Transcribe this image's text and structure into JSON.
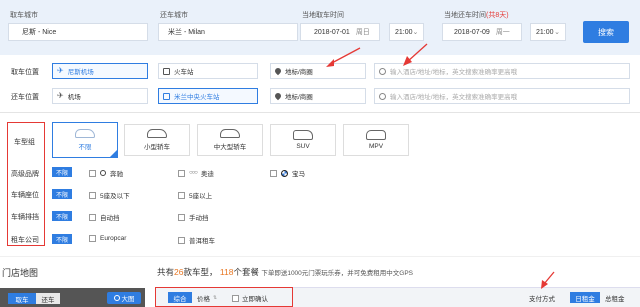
{
  "search": {
    "pickup_city_label": "取车城市",
    "pickup_city": "尼斯 - Nice",
    "return_city_label": "还车城市",
    "return_city": "米兰 - Milan",
    "pickup_time_label": "当地取车时间",
    "pickup_date": "2018-07-01",
    "pickup_weekday": "周日",
    "pickup_hour": "21:00",
    "return_time_label": "当地还车时间",
    "return_days_note": "(共8天)",
    "return_date": "2018-07-09",
    "return_weekday": "周一",
    "return_hour": "21:00",
    "search_button": "搜索"
  },
  "pickup_row": {
    "label": "取车位置",
    "options": [
      "尼斯机场",
      "火车站",
      "地标/商圈"
    ],
    "search_placeholder": "输入酒店/地址/地标，英文搜索准确率更高哦"
  },
  "return_row": {
    "label": "还车位置",
    "options": [
      "机场",
      "米兰中央火车站",
      "地标/商圈"
    ],
    "search_placeholder": "输入酒店/地址/地标，英文搜索准确率更高哦"
  },
  "filters": {
    "car_group_label": "车型组",
    "car_groups": [
      "不限",
      "小型轿车",
      "中大型轿车",
      "SUV",
      "MPV"
    ],
    "brand_label": "高级品牌",
    "brands": [
      "不限",
      "奔驰",
      "奥迪",
      "宝马"
    ],
    "seats_label": "车辆座位",
    "seats": [
      "不限",
      "5座及以下",
      "5座以上"
    ],
    "gear_label": "车辆排挡",
    "gears": [
      "不限",
      "自动挡",
      "手动挡"
    ],
    "company_label": "租车公司",
    "companies": [
      "不限",
      "Europcar",
      "普洱租车"
    ]
  },
  "map": {
    "title": "门店地图",
    "tab_pickup": "取车",
    "tab_return": "还车",
    "big_map": "大图"
  },
  "results": {
    "prefix": "共有",
    "car_count": "26",
    "middle": "款车型，",
    "package_count": "118",
    "suffix": "个套餐",
    "promo": "下单即送1000元门票玩乐券，并可免费租用中文GPS"
  },
  "sort": {
    "overall": "综合",
    "price": "价格",
    "instant_confirm": "立即确认",
    "payment_label": "支付方式",
    "daily_price": "日租金",
    "total_price": "总租金"
  },
  "colors": {
    "accent": "#2f7de1",
    "highlight": "#e53935",
    "count": "#e87722"
  }
}
